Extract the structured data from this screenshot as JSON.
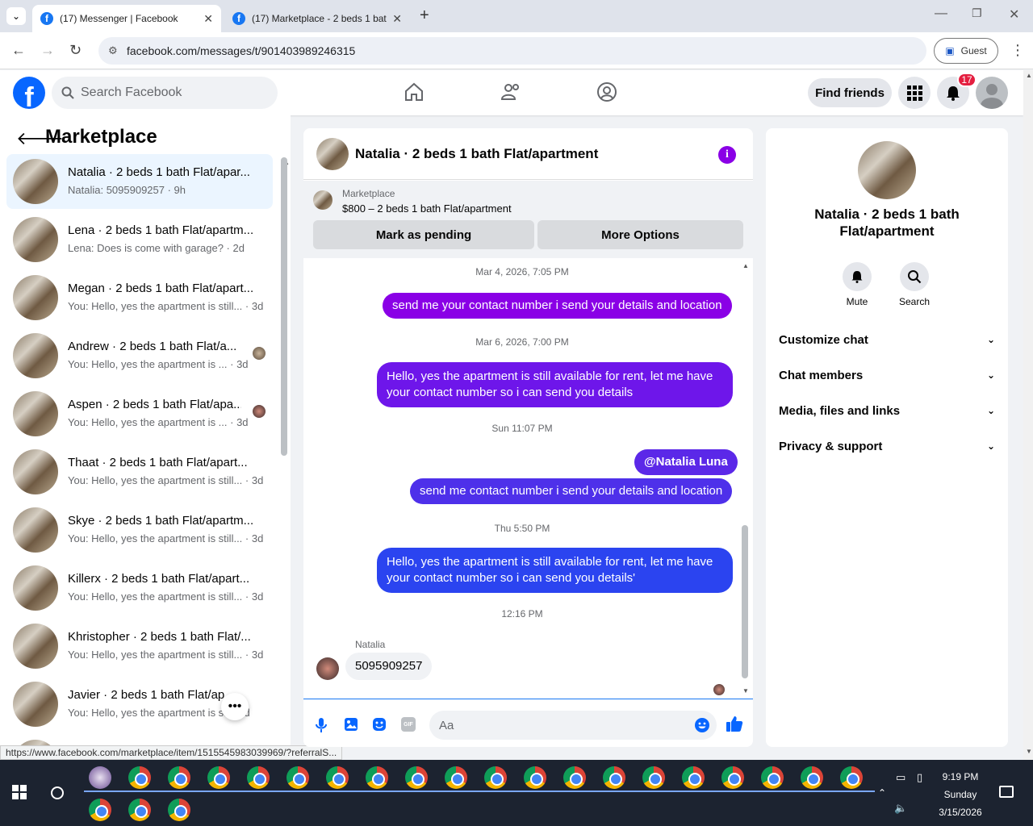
{
  "browser": {
    "tabs": [
      {
        "title": "(17) Messenger | Facebook",
        "active": true
      },
      {
        "title": "(17) Marketplace - 2 beds 1 bat",
        "active": false
      }
    ],
    "url": "facebook.com/messages/t/901403989246315",
    "profile_label": "Guest",
    "status_url": "https://www.facebook.com/marketplace/item/1515545983039969/?referralS..."
  },
  "header": {
    "search_placeholder": "Search Facebook",
    "find_friends": "Find friends",
    "notification_count": "17"
  },
  "sidebar": {
    "title": "Marketplace",
    "conversations": [
      {
        "name": "Natalia · 2 beds 1 bath Flat/apar...",
        "preview": "Natalia: 5095909257 · 9h",
        "selected": true
      },
      {
        "name": "Lena · 2 beds 1 bath Flat/apartm...",
        "preview": "Lena: Does is come with garage? · 2d"
      },
      {
        "name": "Megan · 2 beds 1 bath Flat/apart...",
        "preview": "You: Hello, yes the apartment is still... · 3d"
      },
      {
        "name": "Andrew · 2 beds 1 bath Flat/a...",
        "preview": "You: Hello, yes the apartment is ... · 3d"
      },
      {
        "name": "Aspen · 2 beds 1 bath Flat/apa...",
        "preview": "You: Hello, yes the apartment is ... · 3d"
      },
      {
        "name": "Thaat · 2 beds 1 bath Flat/apart...",
        "preview": "You: Hello, yes the apartment is still... · 3d"
      },
      {
        "name": "Skye · 2 beds 1 bath Flat/apartm...",
        "preview": "You: Hello, yes the apartment is still... · 3d"
      },
      {
        "name": "Killerx · 2 beds 1 bath Flat/apart...",
        "preview": "You: Hello, yes the apartment is still... · 3d"
      },
      {
        "name": "Khristopher · 2 beds 1 bath Flat/...",
        "preview": "You: Hello, yes the apartment is still... · 3d"
      },
      {
        "name": "Javier · 2 beds 1 bath Flat/ap...",
        "preview": "You: Hello, yes the apartment is st... 3d"
      }
    ]
  },
  "chat": {
    "title": "Natalia · 2 beds 1 bath Flat/apartment",
    "marketplace_label": "Marketplace",
    "listing": "$800 – 2 beds 1 bath Flat/apartment",
    "mark_pending": "Mark as pending",
    "more_options": "More Options",
    "timestamps": [
      "Mar 4, 2026, 7:05 PM",
      "Mar 6, 2026, 7:00 PM",
      "Sun 11:07 PM",
      "Thu 5:50 PM",
      "12:16 PM"
    ],
    "messages": [
      "send me your contact number i send your details and location",
      "Hello, yes the apartment is still available for rent, let me have your contact number so i can send you details",
      "@Natalia Luna",
      "send me contact number i send your details and location",
      "Hello, yes the apartment is still available for rent, let me have your contact number so i can send you details'"
    ],
    "incoming_sender": "Natalia",
    "incoming_message": "5095909257",
    "composer_placeholder": "Aa"
  },
  "info_pane": {
    "title": "Natalia · 2 beds 1 bath Flat/apartment",
    "mute": "Mute",
    "search": "Search",
    "sections": [
      "Customize chat",
      "Chat members",
      "Media, files and links",
      "Privacy & support"
    ]
  },
  "taskbar": {
    "time": "9:19 PM",
    "day": "Sunday",
    "date": "3/15/2026"
  },
  "colors": {
    "fb_blue": "#0866ff",
    "purple_bubble": "#8a00e6",
    "violet_bubble": "#5b28e8",
    "blue_bubble": "#2b44f0"
  }
}
